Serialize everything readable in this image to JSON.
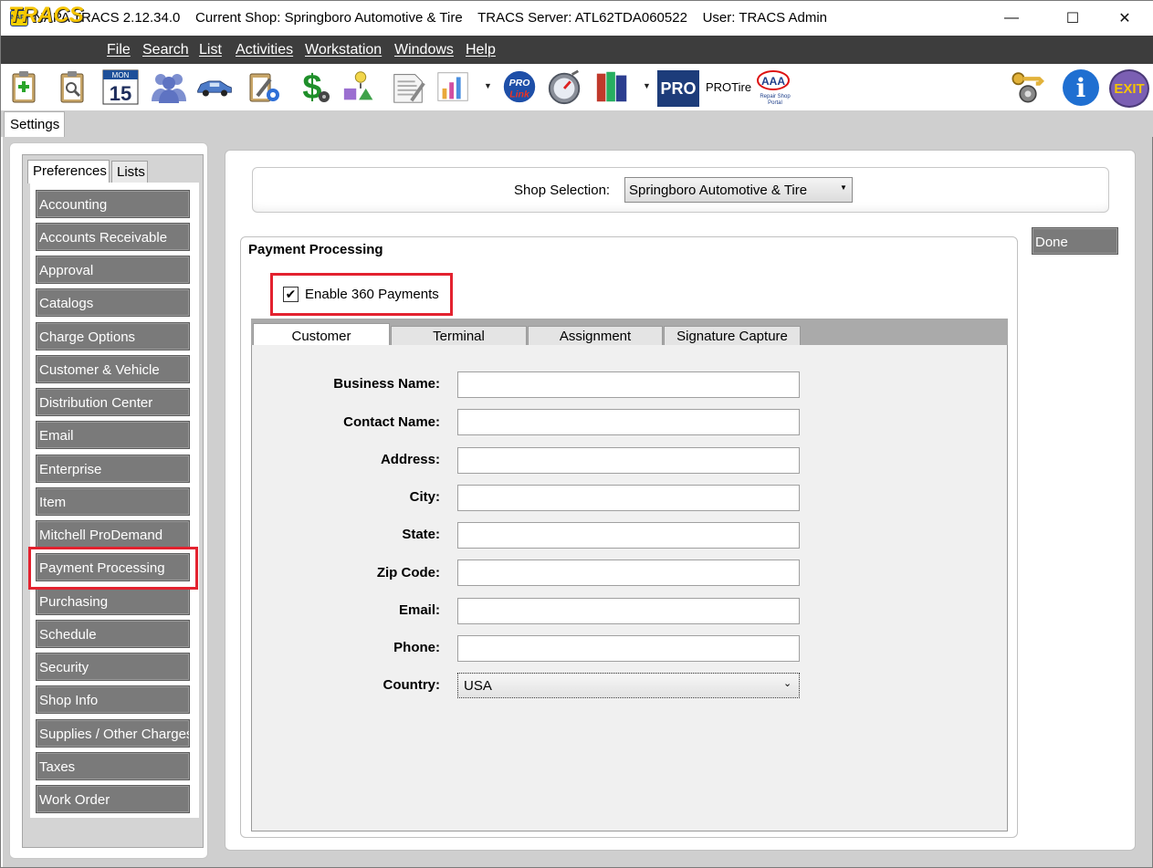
{
  "window": {
    "title": "NAPA TRACS 2.12.34.0    Current Shop: Springboro Automotive & Tire    TRACS Server: ATL62TDA060522    User: TRACS Admin",
    "logo_text": "NAPA",
    "minimize": "—",
    "maximize": "☐",
    "close": "✕"
  },
  "menubar": {
    "logo": "TRACS",
    "items": [
      "File",
      "Search",
      "List",
      "Activities",
      "Workstation",
      "Windows",
      "Help"
    ]
  },
  "toolbar": {
    "calendar_month": "MON",
    "calendar_day": "15",
    "pro_label": "PRO",
    "protire_label": "PROTire",
    "prolink_label": "PRO Link",
    "aaa_label": "AAA",
    "aaa_sub": "Repair Shop Portal",
    "exit_label": "EXIT",
    "info_label": "i"
  },
  "tabs": {
    "settings": "Settings"
  },
  "left": {
    "tabs": [
      "Preferences",
      "Lists"
    ],
    "items": [
      "Accounting",
      "Accounts Receivable",
      "Approval",
      "Catalogs",
      "Charge Options",
      "Customer & Vehicle",
      "Distribution Center",
      "Email",
      "Enterprise",
      "Item",
      "Mitchell ProDemand",
      "Payment Processing",
      "Purchasing",
      "Schedule",
      "Security",
      "Shop Info",
      "Supplies / Other Charges",
      "Taxes",
      "Work Order"
    ],
    "selected": "Payment Processing"
  },
  "shop": {
    "label": "Shop Selection:",
    "value": "Springboro Automotive & Tire"
  },
  "done": "Done",
  "payment": {
    "title": "Payment Processing",
    "enable_label": "Enable 360 Payments",
    "enable_checked": true,
    "check_mark": "✔",
    "tabs": [
      "Customer",
      "Terminal",
      "Assignment",
      "Signature Capture"
    ],
    "active_tab": "Customer",
    "fields": {
      "business_name": {
        "label": "Business Name:",
        "value": ""
      },
      "contact_name": {
        "label": "Contact Name:",
        "value": ""
      },
      "address": {
        "label": "Address:",
        "value": ""
      },
      "city": {
        "label": "City:",
        "value": ""
      },
      "state": {
        "label": "State:",
        "value": ""
      },
      "zip": {
        "label": "Zip Code:",
        "value": ""
      },
      "email": {
        "label": "Email:",
        "value": ""
      },
      "phone": {
        "label": "Phone:",
        "value": ""
      },
      "country": {
        "label": "Country:",
        "value": "USA"
      }
    }
  }
}
